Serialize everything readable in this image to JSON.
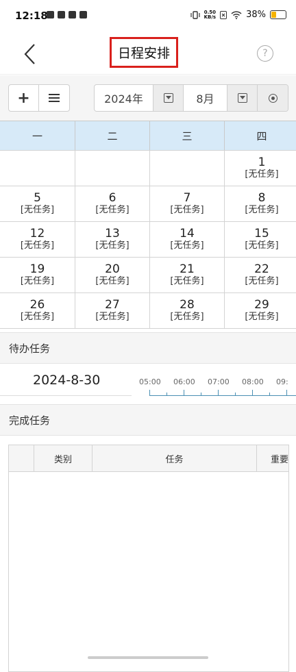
{
  "status_bar": {
    "time": "12:18",
    "net_speed_value": "0.50",
    "net_speed_unit": "KB/s",
    "battery_percent": "38%",
    "battery_level": 0.38,
    "battery_color": "#f5b300"
  },
  "header": {
    "title": "日程安排",
    "help_glyph": "?"
  },
  "toolbar": {
    "add_glyph": "+",
    "year": "2024年",
    "month": "8月"
  },
  "calendar": {
    "weekdays": [
      "一",
      "二",
      "三",
      "四"
    ],
    "rows": [
      [
        {
          "day": "",
          "task": ""
        },
        {
          "day": "",
          "task": ""
        },
        {
          "day": "",
          "task": ""
        },
        {
          "day": "1",
          "task": "[无任务]"
        }
      ],
      [
        {
          "day": "5",
          "task": "[无任务]"
        },
        {
          "day": "6",
          "task": "[无任务]"
        },
        {
          "day": "7",
          "task": "[无任务]"
        },
        {
          "day": "8",
          "task": "[无任务]"
        }
      ],
      [
        {
          "day": "12",
          "task": "[无任务]"
        },
        {
          "day": "13",
          "task": "[无任务]"
        },
        {
          "day": "14",
          "task": "[无任务]"
        },
        {
          "day": "15",
          "task": "[无任务]"
        }
      ],
      [
        {
          "day": "19",
          "task": "[无任务]"
        },
        {
          "day": "20",
          "task": "[无任务]"
        },
        {
          "day": "21",
          "task": "[无任务]"
        },
        {
          "day": "22",
          "task": "[无任务]"
        }
      ],
      [
        {
          "day": "26",
          "task": "[无任务]"
        },
        {
          "day": "27",
          "task": "[无任务]"
        },
        {
          "day": "28",
          "task": "[无任务]"
        },
        {
          "day": "29",
          "task": "[无任务]"
        }
      ]
    ]
  },
  "pending": {
    "heading": "待办任务",
    "date": "2024-8-30",
    "times": [
      "05:00",
      "06:00",
      "07:00",
      "08:00",
      "09:"
    ]
  },
  "done": {
    "heading": "完成任务",
    "columns": [
      "",
      "类别",
      "任务",
      "重要"
    ]
  }
}
